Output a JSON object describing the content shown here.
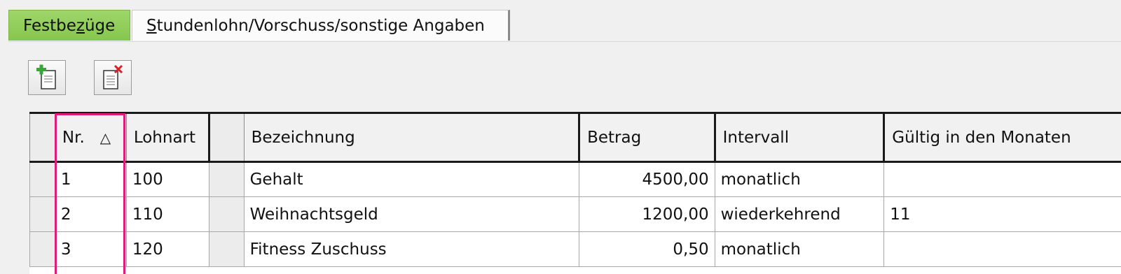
{
  "tabs": {
    "active": {
      "pre": "Festbe",
      "accel": "z",
      "post": "üge"
    },
    "inactive": {
      "accel": "S",
      "post": "tundenlohn/Vorschuss/sonstige Angaben"
    }
  },
  "toolbar": {
    "add_icon": "add-document-icon",
    "delete_icon": "delete-document-icon"
  },
  "table": {
    "headers": {
      "nr": "Nr.",
      "sort_indicator": "△",
      "lohnart": "Lohnart",
      "bezeichnung": "Bezeichnung",
      "betrag": "Betrag",
      "intervall": "Intervall",
      "gueltig": "Gültig in den Monaten"
    },
    "rows": [
      {
        "nr": "1",
        "lohnart": "100",
        "bezeichnung": "Gehalt",
        "betrag": "4500,00",
        "intervall": "monatlich",
        "gueltig": ""
      },
      {
        "nr": "2",
        "lohnart": "110",
        "bezeichnung": "Weihnachtsgeld",
        "betrag": "1200,00",
        "intervall": "wiederkehrend",
        "gueltig": "11"
      },
      {
        "nr": "3",
        "lohnart": "120",
        "bezeichnung": "Fitness Zuschuss",
        "betrag": "0,50",
        "intervall": "monatlich",
        "gueltig": ""
      }
    ]
  },
  "colors": {
    "active_tab": "#8cca55",
    "highlight": "#e01c7a"
  }
}
